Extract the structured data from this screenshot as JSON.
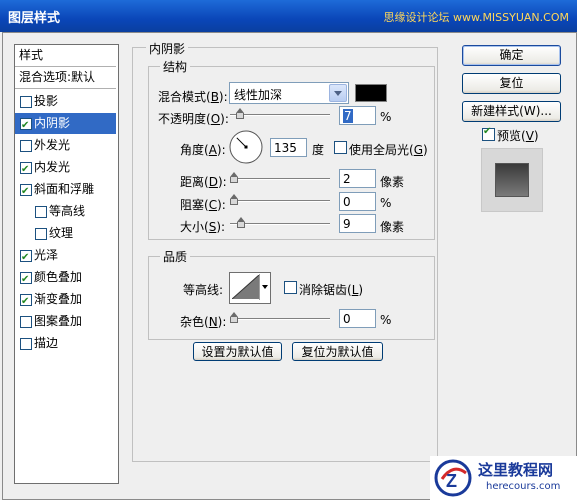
{
  "window": {
    "title": "图层样式",
    "watermark": "思缘设计论坛 www.MISSYUAN.COM"
  },
  "sidebar": {
    "header": "样式",
    "blend": "混合选项:默认",
    "items": [
      {
        "label": "投影",
        "checked": false,
        "selected": false,
        "sub": false
      },
      {
        "label": "内阴影",
        "checked": true,
        "selected": true,
        "sub": false
      },
      {
        "label": "外发光",
        "checked": false,
        "selected": false,
        "sub": false
      },
      {
        "label": "内发光",
        "checked": true,
        "selected": false,
        "sub": false
      },
      {
        "label": "斜面和浮雕",
        "checked": true,
        "selected": false,
        "sub": false
      },
      {
        "label": "等高线",
        "checked": false,
        "selected": false,
        "sub": true
      },
      {
        "label": "纹理",
        "checked": false,
        "selected": false,
        "sub": true
      },
      {
        "label": "光泽",
        "checked": true,
        "selected": false,
        "sub": false
      },
      {
        "label": "颜色叠加",
        "checked": true,
        "selected": false,
        "sub": false
      },
      {
        "label": "渐变叠加",
        "checked": true,
        "selected": false,
        "sub": false
      },
      {
        "label": "图案叠加",
        "checked": false,
        "selected": false,
        "sub": false
      },
      {
        "label": "描边",
        "checked": false,
        "selected": false,
        "sub": false
      }
    ]
  },
  "panel": {
    "title": "内阴影",
    "structure": {
      "title": "结构",
      "blend_mode_label": "混合模式(",
      "blend_mode_key": "B",
      "blend_mode_tail": "):",
      "blend_mode_value": "线性加深",
      "blend_color": "#000000",
      "opacity_label": "不透明度(",
      "opacity_key": "O",
      "opacity_tail": "):",
      "opacity_value": "7",
      "opacity_unit": "%",
      "opacity_level": 0.07,
      "angle_label": "角度(",
      "angle_key": "A",
      "angle_tail": "):",
      "angle_value": "135",
      "angle_unit": "度",
      "global_light_label": "使用全局光(",
      "global_light_key": "G",
      "global_light_tail": ")",
      "global_light_checked": false,
      "distance_label": "距离(",
      "distance_key": "D",
      "distance_tail": "):",
      "distance_value": "2",
      "distance_unit": "像素",
      "choke_label": "阻塞(",
      "choke_key": "C",
      "choke_tail": "):",
      "choke_value": "0",
      "choke_unit": "%",
      "size_label": "大小(",
      "size_key": "S",
      "size_tail": "):",
      "size_value": "9",
      "size_unit": "像素"
    },
    "quality": {
      "title": "品质",
      "contour_label": "等高线:",
      "antialias_label": "消除锯齿(",
      "antialias_key": "L",
      "antialias_tail": ")",
      "antialias_checked": false,
      "noise_label": "杂色(",
      "noise_key": "N",
      "noise_tail": "):",
      "noise_value": "0",
      "noise_unit": "%"
    },
    "set_default": "设置为默认值",
    "reset_default": "复位为默认值"
  },
  "buttons": {
    "ok": "确定",
    "reset": "复位",
    "new_style": "新建样式(W)...",
    "preview_label": "预览(",
    "preview_key": "V",
    "preview_tail": ")",
    "preview_checked": true
  },
  "logo": {
    "name": "这里教程网",
    "url": "herecours.com"
  }
}
